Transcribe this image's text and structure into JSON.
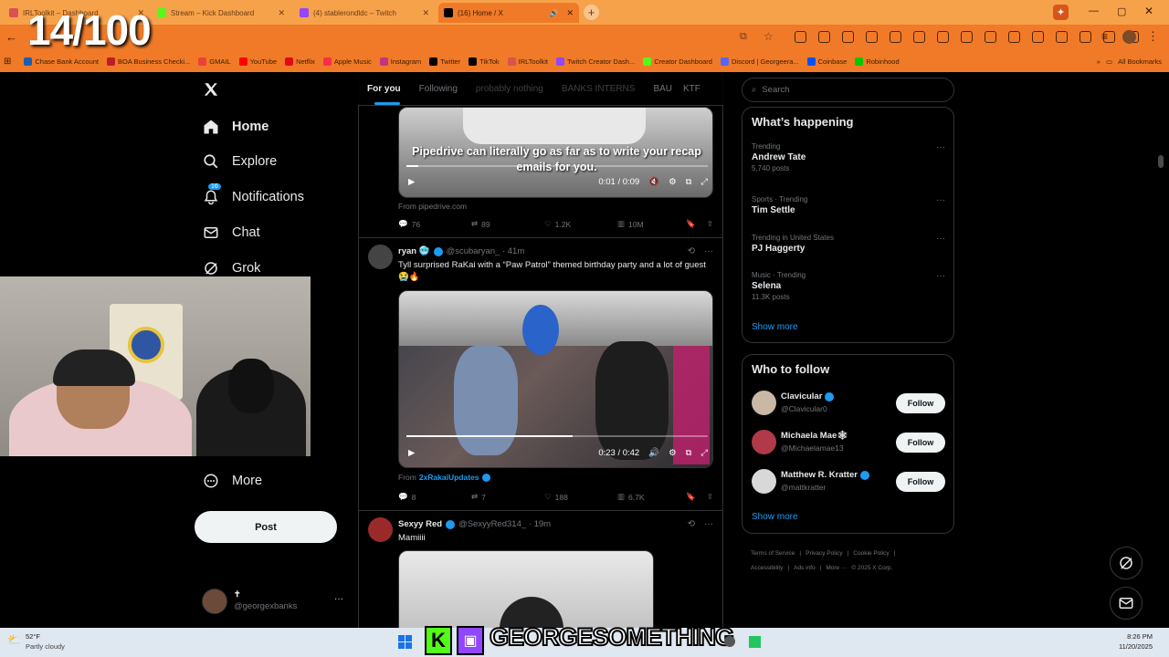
{
  "overlay": {
    "counter": "14/100",
    "banner": "GEORGESOMETHING"
  },
  "browser": {
    "tabs": [
      {
        "label": "IRLToolkit – Dashboard",
        "color": "#d9534f",
        "active": false
      },
      {
        "label": "Stream – Kick Dashboard",
        "color": "#53fc18",
        "active": false
      },
      {
        "label": "(4) stablerondldc – Twitch",
        "color": "#9146ff",
        "active": false
      },
      {
        "label": "(16) Home / X",
        "color": "#000000",
        "active": true
      }
    ],
    "bookmarks": [
      {
        "label": "Chase Bank Account",
        "color": "#1a5fb4"
      },
      {
        "label": "BOA Business Checki...",
        "color": "#c01c28"
      },
      {
        "label": "GMAIL",
        "color": "#ea4335"
      },
      {
        "label": "YouTube",
        "color": "#ff0000"
      },
      {
        "label": "Netflix",
        "color": "#e50914"
      },
      {
        "label": "Apple Music",
        "color": "#fa2d48"
      },
      {
        "label": "Instagram",
        "color": "#c13584"
      },
      {
        "label": "Twitter",
        "color": "#000000"
      },
      {
        "label": "TikTok",
        "color": "#000000"
      },
      {
        "label": "IRLToolkit",
        "color": "#d9534f"
      },
      {
        "label": "Twitch Creator Dash...",
        "color": "#9146ff"
      },
      {
        "label": "Creator Dashboard",
        "color": "#53fc18"
      },
      {
        "label": "Discord | Georgeera...",
        "color": "#5865f2"
      },
      {
        "label": "Coinbase",
        "color": "#0052ff"
      },
      {
        "label": "Robinhood",
        "color": "#00c805"
      }
    ],
    "all_bookmarks": "All Bookmarks"
  },
  "nav": {
    "home": "Home",
    "explore": "Explore",
    "notifications": "Notifications",
    "notif_badge": "16",
    "chat": "Chat",
    "grok": "Grok",
    "more": "More",
    "post": "Post",
    "account": {
      "name": "✝",
      "handle": "@georgexbanks",
      "more": "···"
    }
  },
  "feed": {
    "tabs": [
      "For you",
      "Following",
      "probably nothing",
      "BANKS INTERNS",
      "BAU",
      "KTF"
    ],
    "tweet1": {
      "caption": "Pipedrive can literally go as far as to write your recap emails for you.",
      "time": "0:01 / 0:09",
      "source": "From pipedrive.com",
      "replies": "76",
      "reposts": "89",
      "likes": "1.2K",
      "views": "10M"
    },
    "tweet2": {
      "name": "ryan 🥶",
      "handle": "@scubaryan_ · 41m",
      "text": "Tyll surprised RaKai with a “Paw Patrol” themed birthday party and a lot of guest 😭🔥",
      "time": "0:23 / 0:42",
      "source_prefix": "From",
      "source": "2xRakaiUpdates",
      "replies": "8",
      "reposts": "7",
      "likes": "188",
      "views": "6.7K",
      "progress": 0.55
    },
    "tweet3": {
      "name": "Sexyy Red",
      "handle": "@SexyyRed314_ · 19m",
      "text": "Mamiiii"
    }
  },
  "sidebar": {
    "search_placeholder": "Search",
    "happening_title": "What’s happening",
    "trends": [
      {
        "meta": "Trending",
        "name": "Andrew Tate",
        "posts": "5,740 posts"
      },
      {
        "meta": "Sports · Trending",
        "name": "Tim Settle",
        "posts": ""
      },
      {
        "meta": "Trending in United States",
        "name": "PJ Haggerty",
        "posts": ""
      },
      {
        "meta": "Music · Trending",
        "name": "Selena",
        "posts": "11.3K posts"
      }
    ],
    "show_more": "Show more",
    "follow_title": "Who to follow",
    "follow": [
      {
        "name": "Clavicular",
        "handle": "@Clavicular0",
        "button": "Follow"
      },
      {
        "name": "Michaela Mae🕸",
        "handle": "@Michaelamae13",
        "button": "Follow"
      },
      {
        "name": "Matthew R. Kratter",
        "handle": "@mattkratter",
        "button": "Follow"
      }
    ],
    "footer": {
      "line1": [
        "Terms of Service",
        "|",
        "Privacy Policy",
        "|",
        "Cookie Policy",
        "|"
      ],
      "line2": [
        "Accessibility",
        "|",
        "Ads info",
        "|",
        "More ···",
        "© 2025 X Corp."
      ]
    }
  },
  "taskbar": {
    "temp": "52°F",
    "weather": "Partly cloudy",
    "time": "8:26 PM",
    "date": "11/20/2025"
  }
}
